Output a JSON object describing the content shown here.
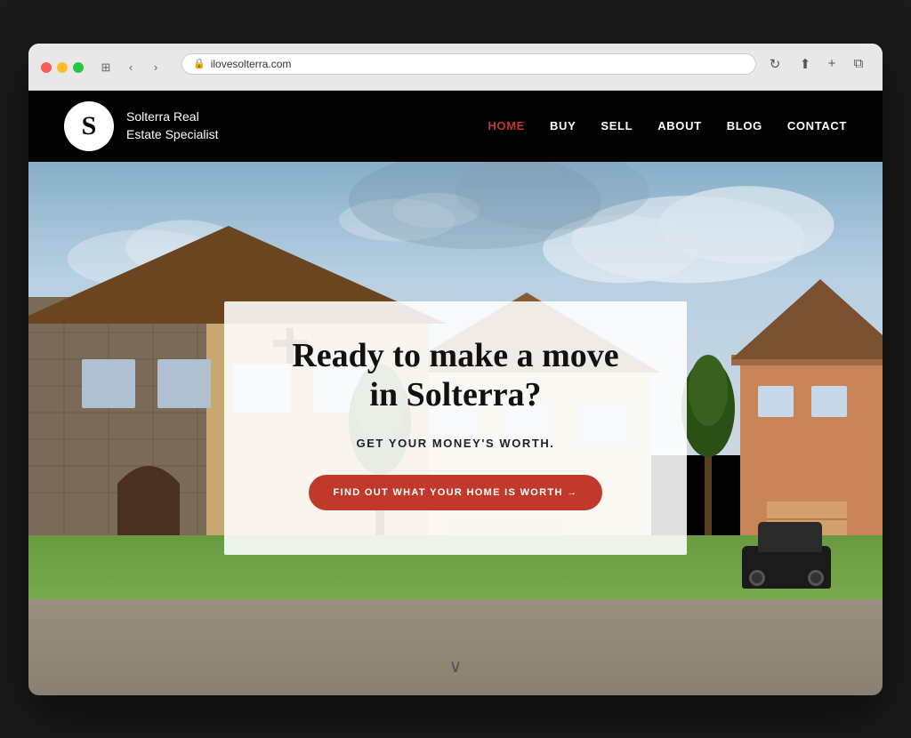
{
  "browser": {
    "url": "ilovesolterra.com",
    "tab_icon": "🔒"
  },
  "nav": {
    "logo_letter": "S",
    "logo_line1": "Solterra Real",
    "logo_line2": "Estate Specialist",
    "links": [
      {
        "label": "HOME",
        "active": true
      },
      {
        "label": "BUY",
        "active": false
      },
      {
        "label": "SELL",
        "active": false
      },
      {
        "label": "ABOUT",
        "active": false
      },
      {
        "label": "BLOG",
        "active": false
      },
      {
        "label": "CONTACT",
        "active": false
      }
    ]
  },
  "hero": {
    "title": "Ready to make a move in Solterra?",
    "subtitle": "GET YOUR MONEY'S WORTH.",
    "cta_label": "FIND OUT WHAT YOUR HOME IS WORTH →",
    "scroll_indicator": "∨"
  }
}
